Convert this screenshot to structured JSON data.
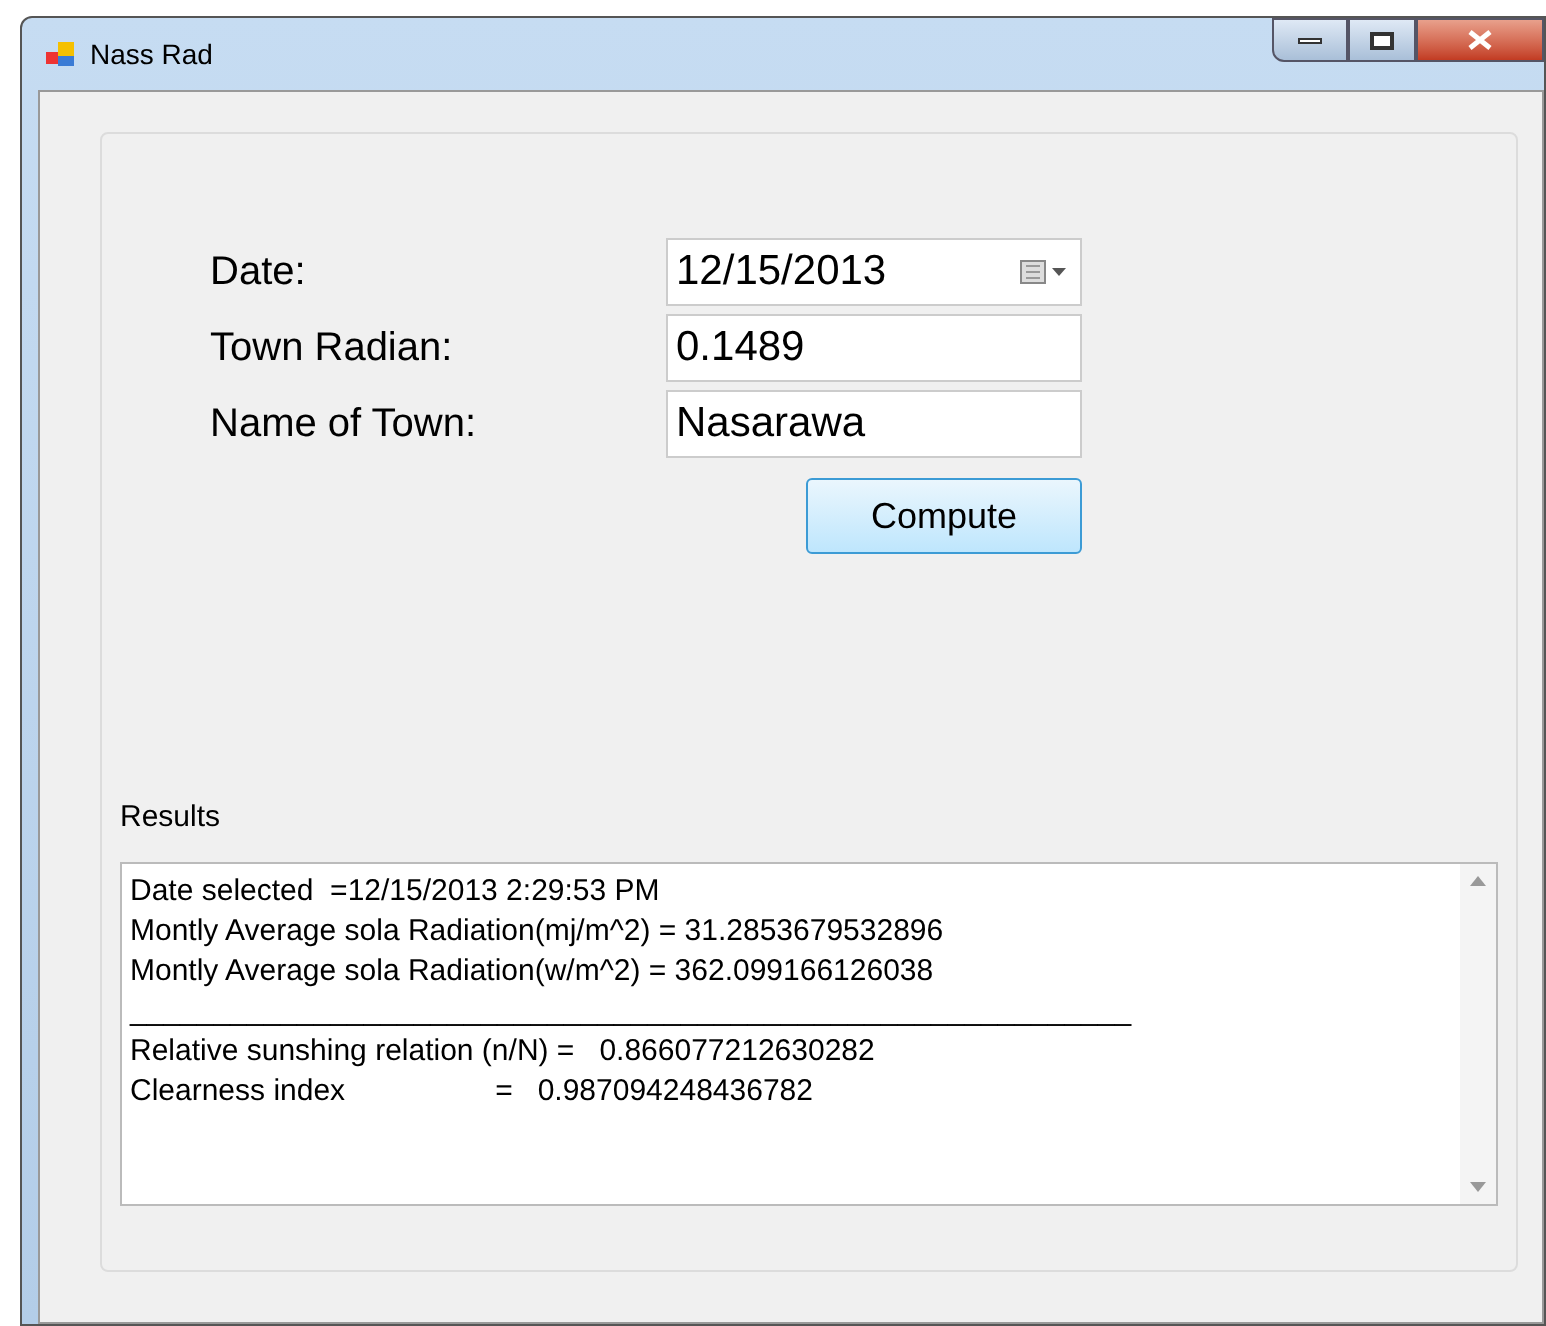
{
  "window": {
    "title": "Nass Rad"
  },
  "form": {
    "fields": [
      {
        "label": "Date:",
        "value": "12/15/2013",
        "kind": "date"
      },
      {
        "label": "Town Radian:",
        "value": "0.1489",
        "kind": "text"
      },
      {
        "label": "Name of Town:",
        "value": "Nasarawa",
        "kind": "text"
      }
    ],
    "button": "Compute"
  },
  "results": {
    "label": "Results",
    "lines": [
      "Date selected  =12/15/2013 2:29:53 PM",
      "Montly Average sola Radiation(mj/m^2) = 31.2853679532896",
      "Montly Average sola Radiation(w/m^2) = 362.099166126038",
      "____________________________________________________________",
      "Relative sunshing relation (n/N) =   0.866077212630282",
      "Clearness index                  =   0.987094248436782"
    ]
  }
}
